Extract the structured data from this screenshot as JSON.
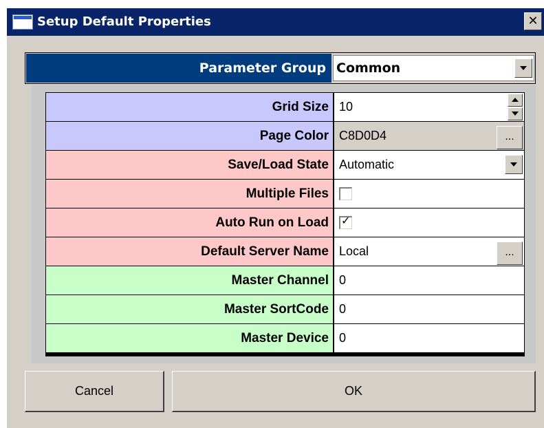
{
  "window": {
    "title": "Setup Default Properties",
    "close_glyph": "✕"
  },
  "parameter_group": {
    "label": "Parameter Group",
    "value": "Common"
  },
  "properties": [
    {
      "label": "Grid Size",
      "value": "10",
      "editor": "spinner",
      "color": "#c8c8ff"
    },
    {
      "label": "Page Color",
      "value": "C8D0D4",
      "editor": "browse",
      "readonly": true,
      "color": "#c8c8ff"
    },
    {
      "label": "Save/Load State",
      "value": "Automatic",
      "editor": "dropdown",
      "color": "#ffc8c8"
    },
    {
      "label": "Multiple Files",
      "checked": false,
      "editor": "checkbox",
      "color": "#ffc8c8"
    },
    {
      "label": "Auto Run on Load",
      "checked": true,
      "editor": "checkbox",
      "color": "#ffc8c8"
    },
    {
      "label": "Default Server Name",
      "value": "Local",
      "editor": "browse",
      "color": "#ffc8c8"
    },
    {
      "label": "Master Channel",
      "value": "0",
      "editor": "text",
      "color": "#c8ffc8"
    },
    {
      "label": "Master SortCode",
      "value": "0",
      "editor": "text",
      "color": "#c8ffc8"
    },
    {
      "label": "Master Device",
      "value": "0",
      "editor": "text",
      "color": "#c8ffc8"
    }
  ],
  "ellipsis_label": "...",
  "check_glyph": "✓",
  "buttons": {
    "cancel": "Cancel",
    "ok": "OK"
  },
  "colors": {
    "titlebar": "#0a246a",
    "parameter_group_bg": "#003c7e",
    "dialog_bg": "#d4d0c8"
  }
}
